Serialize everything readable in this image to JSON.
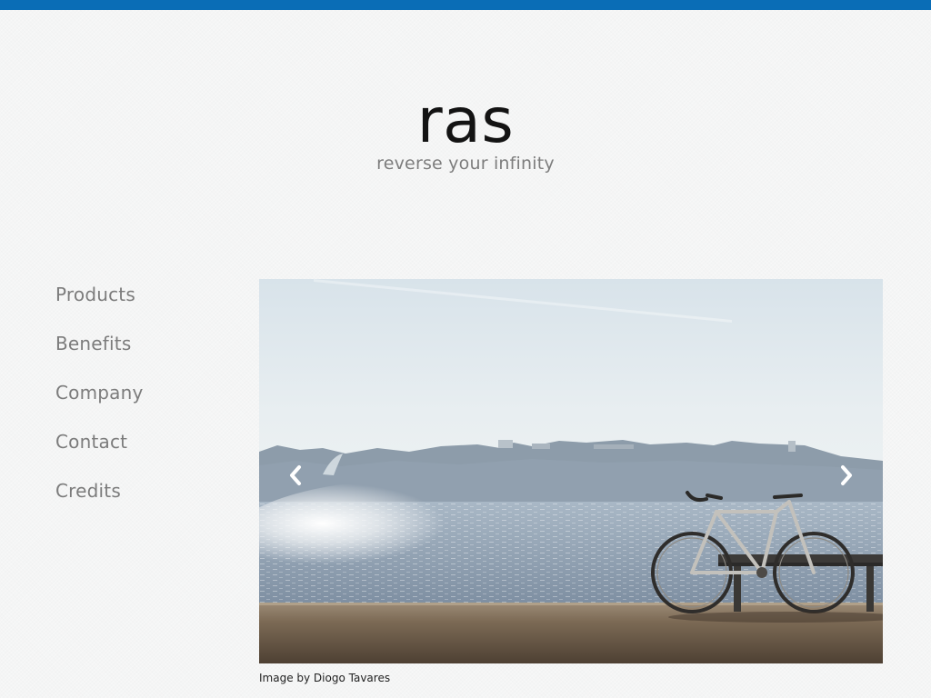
{
  "site": {
    "title": "ras",
    "tagline": "reverse your infinity",
    "brand_color": "#0a6db6"
  },
  "nav": {
    "items": [
      {
        "label": "Products"
      },
      {
        "label": "Benefits"
      },
      {
        "label": "Company"
      },
      {
        "label": "Contact"
      },
      {
        "label": "Credits"
      }
    ]
  },
  "slider": {
    "image_subject": "bicycle-by-the-sea-photo",
    "prev_icon": "chevron-left-icon",
    "next_icon": "chevron-right-icon",
    "caption": "Image by Diogo Tavares"
  }
}
